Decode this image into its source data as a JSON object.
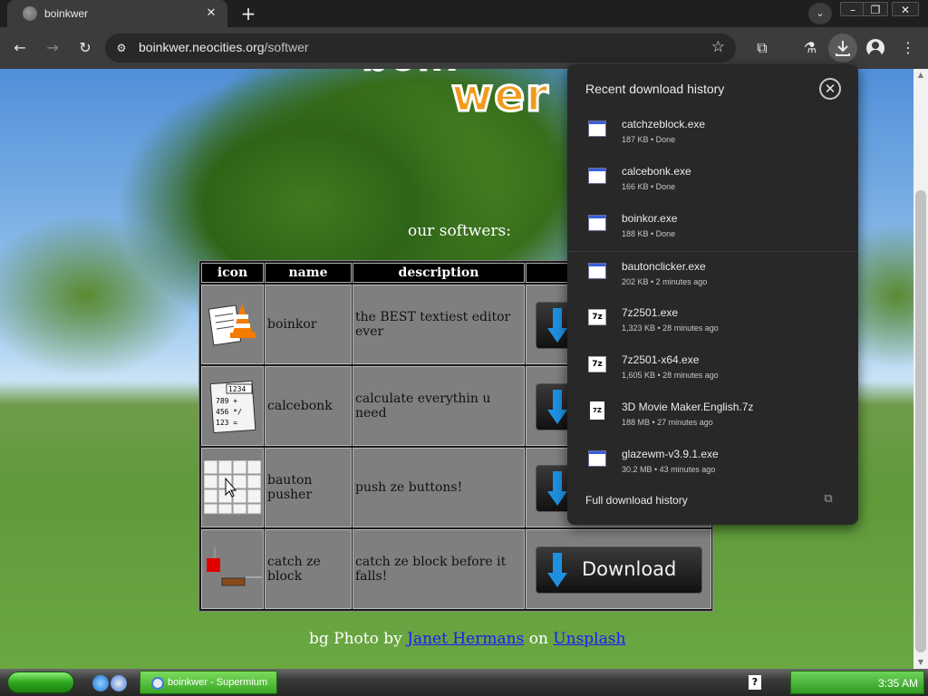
{
  "browser": {
    "tab_title": "boinkwer",
    "url_host": "boinkwer.neocities.org",
    "url_path": "/softwer"
  },
  "page": {
    "logo_text": "wer",
    "subtitle": "our softwers:",
    "table_headers": [
      "icon",
      "name",
      "description",
      ""
    ],
    "rows": [
      {
        "name": "boinkor",
        "description": "the BEST textiest editor ever",
        "icon": "notepad-cone-icon"
      },
      {
        "name": "calcebonk",
        "description": "calculate everythin u need",
        "icon": "calculator-icon"
      },
      {
        "name": "bauton pusher",
        "description": "push ze buttons!",
        "icon": "button-grid-icon"
      },
      {
        "name": "catch ze block",
        "description": "catch ze block before it falls!",
        "icon": "block-game-icon"
      }
    ],
    "download_label": "Download",
    "credit": {
      "prefix": "bg Photo by",
      "author": "Janet Hermans",
      "middle": "on",
      "site": "Unsplash"
    }
  },
  "downloads": {
    "title": "Recent download history",
    "items": [
      {
        "name": "catchzeblock.exe",
        "meta": "187 KB • Done",
        "type": "exe"
      },
      {
        "name": "calcebonk.exe",
        "meta": "166 KB • Done",
        "type": "exe"
      },
      {
        "name": "boinkor.exe",
        "meta": "188 KB • Done",
        "type": "exe"
      },
      {
        "name": "bautonclicker.exe",
        "meta": "202 KB • 2 minutes ago",
        "type": "exe"
      },
      {
        "name": "7z2501.exe",
        "meta": "1,323 KB • 28 minutes ago",
        "type": "7z"
      },
      {
        "name": "7z2501-x64.exe",
        "meta": "1,605 KB • 28 minutes ago",
        "type": "7z"
      },
      {
        "name": "3D Movie Maker.English.7z",
        "meta": "188 MB • 27 minutes ago",
        "type": "doc"
      },
      {
        "name": "glazewm-v3.9.1.exe",
        "meta": "30.2 MB • 43 minutes ago",
        "type": "exe"
      }
    ],
    "full_history_label": "Full download history"
  },
  "taskbar": {
    "task_label": "boinkwer - Supermium",
    "clock": "3:35 AM"
  },
  "colors": {
    "accent_download_blue": "#1e90e0",
    "logo_orange": "#f39a1b",
    "link_blue": "#1a1aff"
  }
}
